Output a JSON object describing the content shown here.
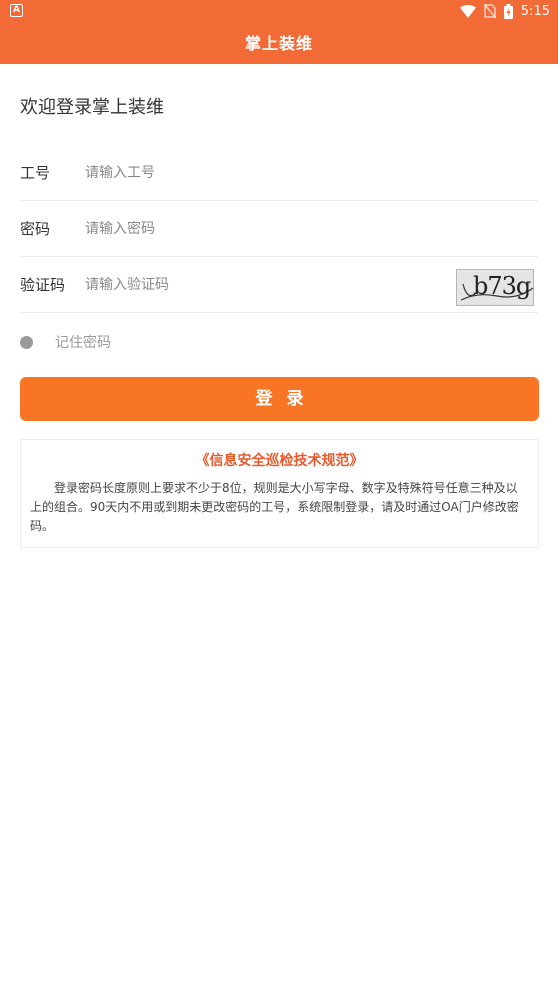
{
  "status_bar": {
    "time": "5:15",
    "left_icon": "A"
  },
  "app": {
    "title": "掌上装维",
    "welcome": "欢迎登录掌上装维"
  },
  "form": {
    "employee_id": {
      "label": "工号",
      "placeholder": "请输入工号"
    },
    "password": {
      "label": "密码",
      "placeholder": "请输入密码"
    },
    "captcha": {
      "label": "验证码",
      "placeholder": "请输入验证码",
      "image_text": "b73g"
    },
    "remember_label": "记住密码",
    "login_button": "登录"
  },
  "notice": {
    "title": "《信息安全巡检技术规范》",
    "body": "登录密码长度原则上要求不少于8位，规则是大小写字母、数字及特殊符号任意三种及以上的组合。90天内不用或到期未更改密码的工号，系统限制登录，请及时通过OA门户修改密码。"
  },
  "colors": {
    "app_bar": "#f26a35",
    "button": "#f77525",
    "notice_title": "#e85a2b"
  }
}
